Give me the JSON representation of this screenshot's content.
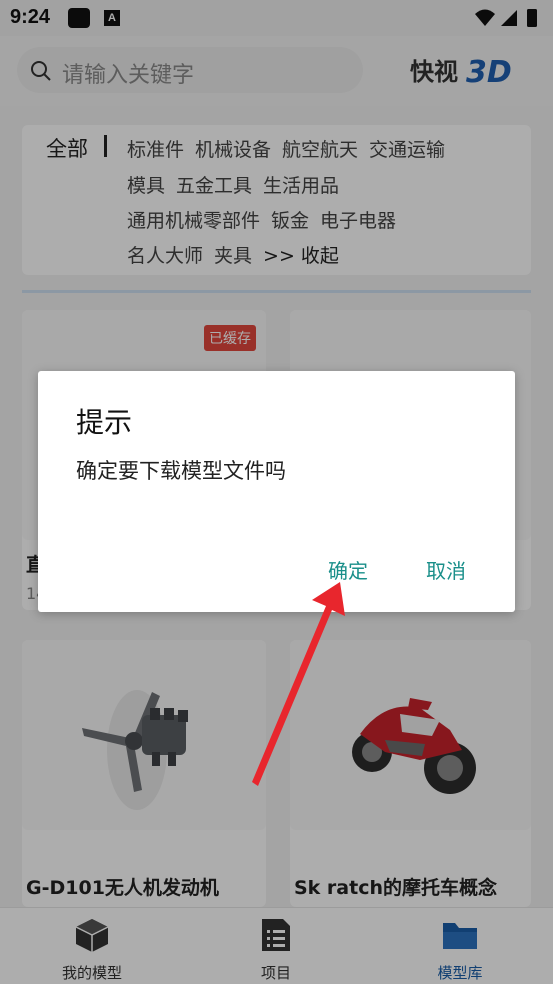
{
  "status_bar": {
    "time": "9:24",
    "icon_a": "A"
  },
  "header": {
    "search_placeholder": "请输入关键字",
    "logo": "快视3D"
  },
  "categories": {
    "all": "全部",
    "rows": [
      [
        "标准件",
        "机械设备",
        "航空航天",
        "交通运输"
      ],
      [
        "模具",
        "五金工具",
        "生活用品"
      ],
      [
        "通用机械零部件",
        "钣金",
        "电子电器"
      ],
      [
        "名人大师",
        "夹具",
        ">> 收起"
      ]
    ]
  },
  "cards": [
    {
      "title": "直",
      "sub": "14",
      "badge": "已缓存"
    },
    {
      "title": "",
      "sub": ""
    },
    {
      "title": "G-D101无人机发动机",
      "sub": ""
    },
    {
      "title": "Sk ratch的摩托车概念",
      "sub": ""
    }
  ],
  "bottom_nav": [
    {
      "label": "我的模型",
      "icon": "cube-icon"
    },
    {
      "label": "项目",
      "icon": "list-icon"
    },
    {
      "label": "模型库",
      "icon": "folder-icon",
      "active": true
    }
  ],
  "dialog": {
    "title": "提示",
    "message": "确定要下载模型文件吗",
    "confirm": "确定",
    "cancel": "取消"
  },
  "colors": {
    "accent": "#1a8f8a",
    "nav_active": "#1a5ea8",
    "badge": "#e2483d",
    "arrow": "#e8262d"
  }
}
